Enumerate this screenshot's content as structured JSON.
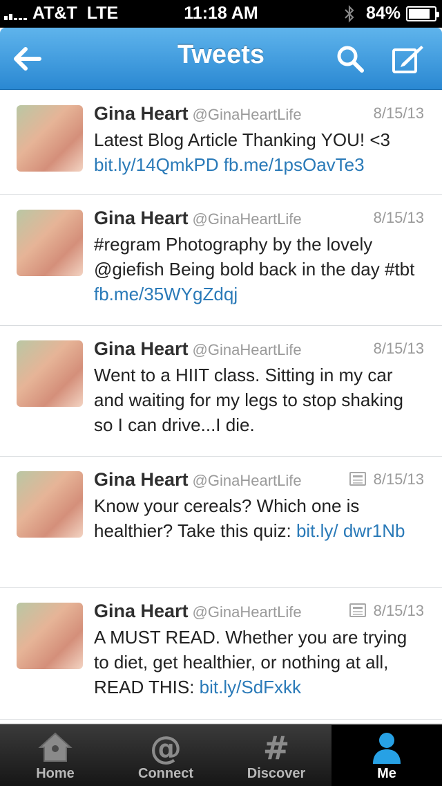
{
  "status_bar": {
    "carrier": "AT&T",
    "network": "LTE",
    "time": "11:18 AM",
    "battery": "84%",
    "battery_level": 0.84
  },
  "nav": {
    "title": "Tweets"
  },
  "tweets": [
    {
      "name": "Gina Heart",
      "handle": "@GinaHeartLife",
      "date": "8/15/13",
      "text": "Latest Blog Article Thanking YOU! <3",
      "links": "bit.ly/14QmkPD fb.me/1psOavTe3"
    },
    {
      "name": "Gina Heart",
      "handle": "@GinaHeartLife",
      "date": "8/15/13",
      "text": "#regram Photography by the lovely @giefish Being bold back in the day #tbt",
      "links": "fb.me/35WYgZdqj"
    },
    {
      "name": "Gina Heart",
      "handle": "@GinaHeartLife",
      "date": "8/15/13",
      "text": "Went to a HIIT class. Sitting in my car and waiting for my legs to stop shaking so I can drive...I die.",
      "links": ""
    },
    {
      "name": "Gina Heart",
      "handle": "@GinaHeartLife",
      "date": "8/15/13",
      "text": "Know your cereals? Which one is healthier? Take this quiz:",
      "links": "bit.ly/ dwr1Nb"
    },
    {
      "name": "Gina Heart",
      "handle": "@GinaHeartLife",
      "date": "8/15/13",
      "text": "A MUST READ. Whether you are trying to diet, get healthier, or nothing at all, READ THIS:",
      "links": "bit.ly/SdFxkk"
    }
  ],
  "tab_bar": {
    "tabs": [
      {
        "label": "Home"
      },
      {
        "label": "Connect"
      },
      {
        "label": "Discover"
      },
      {
        "label": "Me"
      }
    ]
  },
  "icons": {
    "back": "back-arrow-icon",
    "search": "search-icon",
    "compose": "compose-icon"
  },
  "colors": {
    "nav_blue": "#2a88d2",
    "link_blue": "#2a7ab8",
    "me_tab_blue": "#27a1e5"
  }
}
